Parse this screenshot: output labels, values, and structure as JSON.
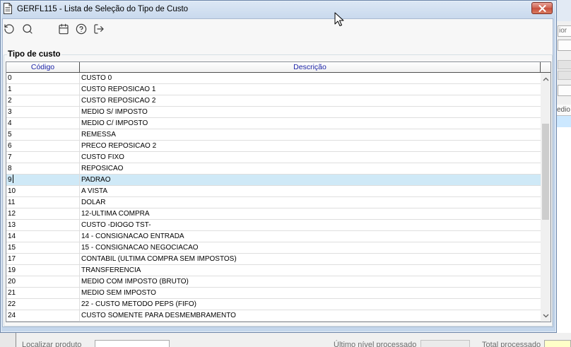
{
  "window": {
    "title": "GERFL115 - Lista de Seleção do Tipo de Custo",
    "title_icon": "document-icon",
    "close_icon": "close-icon"
  },
  "toolbar": {
    "buttons": [
      {
        "icon": "refresh-icon"
      },
      {
        "icon": "search-icon"
      },
      {
        "icon": "calendar-icon"
      },
      {
        "icon": "help-icon"
      },
      {
        "icon": "exit-icon"
      }
    ]
  },
  "group": {
    "label": "Tipo de custo"
  },
  "table": {
    "columns": [
      {
        "label": "Código"
      },
      {
        "label": "Descrição"
      }
    ],
    "selected_code": "9",
    "rows": [
      {
        "code": "0",
        "description": "CUSTO 0"
      },
      {
        "code": "1",
        "description": "CUSTO REPOSICAO 1"
      },
      {
        "code": "2",
        "description": "CUSTO REPOSICAO 2"
      },
      {
        "code": "3",
        "description": "MEDIO S/ IMPOSTO"
      },
      {
        "code": "4",
        "description": "MEDIO C/ IMPOSTO"
      },
      {
        "code": "5",
        "description": "REMESSA"
      },
      {
        "code": "6",
        "description": "PRECO REPOSICAO 2"
      },
      {
        "code": "7",
        "description": "CUSTO FIXO"
      },
      {
        "code": "8",
        "description": "REPOSICAO"
      },
      {
        "code": "9",
        "description": "PADRAO"
      },
      {
        "code": "10",
        "description": "A VISTA"
      },
      {
        "code": "11",
        "description": "DOLAR"
      },
      {
        "code": "12",
        "description": "12-ULTIMA COMPRA"
      },
      {
        "code": "13",
        "description": "CUSTO -DIOGO TST-"
      },
      {
        "code": "14",
        "description": "14 - CONSIGNACAO ENTRADA"
      },
      {
        "code": "15",
        "description": "15 - CONSIGNACAO NEGOCIACAO"
      },
      {
        "code": "17",
        "description": "CONTABIL (ULTIMA COMPRA SEM IMPOSTOS)"
      },
      {
        "code": "19",
        "description": "TRANSFERENCIA"
      },
      {
        "code": "20",
        "description": "MEDIO COM IMPOSTO (BRUTO)"
      },
      {
        "code": "21",
        "description": "MEDIO SEM IMPOSTO"
      },
      {
        "code": "22",
        "description": "22 - CUSTO METODO PEPS (FIFO)"
      },
      {
        "code": "24",
        "description": "CUSTO SOMENTE PARA DESMEMBRAMENTO"
      }
    ],
    "scrollbar": {
      "up_icon": "chevron-up-icon",
      "down_icon": "chevron-down-icon"
    }
  },
  "background_window": {
    "side_fragments": [
      "ior",
      "edio"
    ],
    "bottom": {
      "search_label": "Localizar produto",
      "last_level_label": "Último nível processado",
      "total_label": "Total processado"
    }
  },
  "cursor": {
    "icon": "mouse-pointer-icon"
  },
  "colors": {
    "titlebar": "#c9d9ed",
    "close_button": "#c74f3d",
    "header_text": "#1d24a8",
    "selected_row": "#cfe9f7",
    "total_field": "#ffffc8"
  }
}
